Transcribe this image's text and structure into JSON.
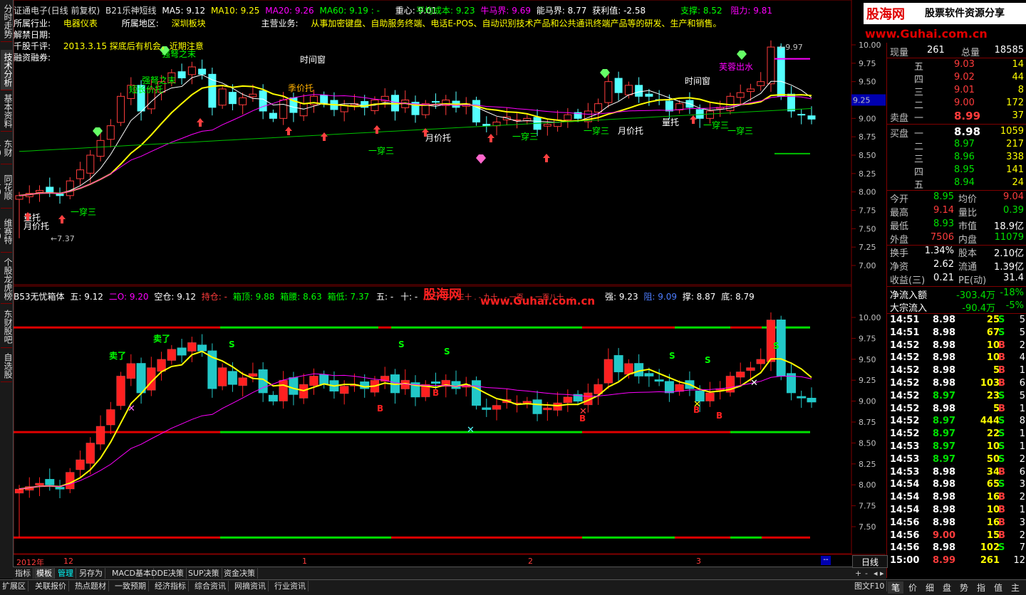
{
  "left_tabs": [
    {
      "label": "分时走势"
    },
    {
      "label": "技术分析"
    },
    {
      "label": "基本资料"
    },
    {
      "label": "东财10"
    },
    {
      "label": "同花顺10"
    },
    {
      "label": "维赛特10"
    },
    {
      "label": "个股龙虎榜"
    },
    {
      "label": "东财股吧"
    },
    {
      "label": "自选股"
    }
  ],
  "main_header": {
    "title": "证通电子(日线 前复权)",
    "indicator": "B21乐神短线",
    "ma5": "MA5: 9.12",
    "ma10": "MA10: 9.25",
    "ma20": "MA20: 9.26",
    "ma60": "MA60: 9.19",
    "ma60_tail": ": -",
    "zhongxin": "重心: 9.01",
    "pingjun": "平均成本: 9.23",
    "niuma": "牛马界: 9.69",
    "nengma": "能马界: 8.77",
    "huoli": "获利值: -2.58",
    "zhicheng": "支撑: 8.52",
    "zuli": "阻力: 9.81"
  },
  "info": {
    "industry_label": "所属行业:",
    "industry": "电器仪表",
    "region_label": "所属地区:",
    "region": "深圳板块",
    "business_label": "主营业务:",
    "business": "从事加密键盘、自助服务终端、电话E-POS、自动识别技术产品和公共通讯终端产品等的研发、生产和销售。",
    "unban_label": "解禁日期:",
    "review_label": "千股千评:",
    "review": "2013.3.15 探底后有机会，近期注意",
    "margin_label": "融资融券:"
  },
  "upper_labels": [
    "强弩之末",
    "强弩之末",
    "短长价托",
    "时间窗",
    "季价托",
    "月价托",
    "一穿三",
    "一穿三",
    "一穿三",
    "月价托",
    "量托",
    "时间窗",
    "芙蓉出水",
    "一穿三",
    "一穿三",
    "量托",
    "月价托",
    "一穿三"
  ],
  "upper_yaxis": [
    "10.00",
    "9.75",
    "9.50",
    "9.25",
    "9.00",
    "8.75",
    "8.50",
    "8.25",
    "8.00",
    "7.75",
    "7.50",
    "7.25",
    "7.00"
  ],
  "price_marks": {
    "high": "9.97",
    "low": "7.37",
    "current": "9.25"
  },
  "lower_header": {
    "name": "B53无忧箱体",
    "wu": "五: 9.12",
    "er": "二O: 9.20",
    "kongcang": "空仓: 9.12",
    "chicang": "持仓: -",
    "xiangding": "箱顶: 9.88",
    "xiangyao": "箱腰: 8.63",
    "xiangdi": "箱低: 7.37",
    "wu2": "五: -",
    "shi": "十: -",
    "ershi": "二十: -",
    "mid_partial": "三十  .  -  九十  .  -   一百  .  -    一百八十  .  -",
    "qiang": "强: 9.23",
    "zu": "阻: 9.09",
    "cheng": "撑: 8.87",
    "di": "底: 8.79"
  },
  "lower_labels": [
    "卖了",
    "卖了",
    "S",
    "S",
    "S",
    "S",
    "S",
    "S",
    "B",
    "B",
    "B",
    "B",
    "B"
  ],
  "lower_yaxis": [
    "10.00",
    "9.75",
    "9.50",
    "9.25",
    "9.00",
    "8.75",
    "8.50",
    "8.25",
    "8.00",
    "7.75",
    "7.50"
  ],
  "xaxis": {
    "year": "2012年",
    "m12": "12",
    "m1": "1",
    "m2": "2",
    "m3": "3"
  },
  "watermark": {
    "brand": "股海网",
    "sub": "股票软件资源分享",
    "url": "www.Guhai.com.cn"
  },
  "center_watermark": {
    "brand": "股海网",
    "url": "www.Guhai.com.cn"
  },
  "quote": {
    "xianliang_label": "现量",
    "xianliang": "261",
    "zongliang_label": "总量",
    "zongliang": "18585",
    "sell": [
      {
        "lv": "五",
        "price": "9.03",
        "vol": "14"
      },
      {
        "lv": "四",
        "price": "9.02",
        "vol": "44"
      },
      {
        "lv": "三",
        "price": "9.01",
        "vol": "8"
      },
      {
        "lv": "二",
        "price": "9.00",
        "vol": "172"
      },
      {
        "lv": "一",
        "price": "8.99",
        "vol": "37"
      }
    ],
    "sell_label": "卖盘",
    "buy_label": "买盘",
    "buy": [
      {
        "lv": "一",
        "price": "8.98",
        "vol": "1059"
      },
      {
        "lv": "二",
        "price": "8.97",
        "vol": "217"
      },
      {
        "lv": "三",
        "price": "8.96",
        "vol": "338"
      },
      {
        "lv": "四",
        "price": "8.95",
        "vol": "141"
      },
      {
        "lv": "五",
        "price": "8.94",
        "vol": "24"
      }
    ],
    "stats": [
      {
        "l1": "今开",
        "v1": "8.95",
        "l2": "均价",
        "v2": "9.04",
        "c1": "green",
        "c2": "red"
      },
      {
        "l1": "最高",
        "v1": "9.14",
        "l2": "量比",
        "v2": "0.39",
        "c1": "red",
        "c2": "green"
      },
      {
        "l1": "最低",
        "v1": "8.93",
        "l2": "市值",
        "v2": "18.9亿",
        "c1": "green",
        "c2": "white"
      },
      {
        "l1": "外盘",
        "v1": "7506",
        "l2": "内盘",
        "v2": "11079",
        "c1": "red",
        "c2": "green"
      },
      {
        "l1": "换手",
        "v1": "1.34%",
        "l2": "股本",
        "v2": "2.10亿",
        "c1": "white",
        "c2": "white"
      },
      {
        "l1": "净资",
        "v1": "2.62",
        "l2": "流通",
        "v2": "1.39亿",
        "c1": "white",
        "c2": "white"
      },
      {
        "l1": "收益(三)",
        "v1": "0.21",
        "l2": "PE(动)",
        "v2": "31.4",
        "c1": "white",
        "c2": "white"
      }
    ],
    "netflow_label": "净流入额",
    "netflow": "-303.4万",
    "netflow_pct": "-18%",
    "bigflow_label": "大宗流入",
    "bigflow": "-90.4万",
    "bigflow_pct": "-5%"
  },
  "ticks": [
    {
      "t": "14:51",
      "p": "8.98",
      "v": "25",
      "s": "S",
      "n": "5",
      "pc": "white"
    },
    {
      "t": "14:51",
      "p": "8.98",
      "v": "67",
      "s": "S",
      "n": "5",
      "pc": "white"
    },
    {
      "t": "14:52",
      "p": "8.98",
      "v": "10",
      "s": "B",
      "n": "2",
      "pc": "white"
    },
    {
      "t": "14:52",
      "p": "8.98",
      "v": "10",
      "s": "B",
      "n": "4",
      "pc": "white"
    },
    {
      "t": "14:52",
      "p": "8.98",
      "v": "5",
      "s": "B",
      "n": "1",
      "pc": "white"
    },
    {
      "t": "14:52",
      "p": "8.98",
      "v": "103",
      "s": "B",
      "n": "6",
      "pc": "white"
    },
    {
      "t": "14:52",
      "p": "8.97",
      "v": "23",
      "s": "S",
      "n": "5",
      "pc": "green"
    },
    {
      "t": "14:52",
      "p": "8.98",
      "v": "5",
      "s": "B",
      "n": "1",
      "pc": "white"
    },
    {
      "t": "14:52",
      "p": "8.97",
      "v": "444",
      "s": "S",
      "n": "8",
      "pc": "green"
    },
    {
      "t": "14:52",
      "p": "8.97",
      "v": "22",
      "s": "S",
      "n": "1",
      "pc": "green"
    },
    {
      "t": "14:53",
      "p": "8.97",
      "v": "10",
      "s": "S",
      "n": "1",
      "pc": "green"
    },
    {
      "t": "14:53",
      "p": "8.97",
      "v": "50",
      "s": "S",
      "n": "2",
      "pc": "green"
    },
    {
      "t": "14:53",
      "p": "8.98",
      "v": "34",
      "s": "B",
      "n": "6",
      "pc": "white"
    },
    {
      "t": "14:54",
      "p": "8.98",
      "v": "65",
      "s": "S",
      "n": "3",
      "pc": "white"
    },
    {
      "t": "14:54",
      "p": "8.98",
      "v": "16",
      "s": "B",
      "n": "2",
      "pc": "white"
    },
    {
      "t": "14:54",
      "p": "8.98",
      "v": "10",
      "s": "B",
      "n": "1",
      "pc": "white"
    },
    {
      "t": "14:56",
      "p": "8.98",
      "v": "16",
      "s": "B",
      "n": "3",
      "pc": "white"
    },
    {
      "t": "14:56",
      "p": "9.00",
      "v": "15",
      "s": "B",
      "n": "2",
      "pc": "red"
    },
    {
      "t": "14:56",
      "p": "8.98",
      "v": "102",
      "s": "S",
      "n": "7",
      "pc": "white"
    },
    {
      "t": "15:00",
      "p": "8.99",
      "v": "261",
      "s": "",
      "n": "12",
      "pc": "red"
    }
  ],
  "toolbar": {
    "zhibiao": "指标",
    "moban": "模板",
    "guanli": "管理",
    "lingcunwei": "另存为",
    "macd": "MACD基本",
    "dde": "DDE决策",
    "sup": "SUP决策",
    "zijin": "资金决策"
  },
  "bottom_tabs": [
    "扩展区",
    "关联报价",
    "热点题材",
    "一致预期",
    "经济指标",
    "综合资讯",
    "网摘资讯",
    "行业资讯"
  ],
  "right_bottom": {
    "rixian": "日线",
    "tuwen": "图文F10"
  },
  "right_icons": [
    "笔",
    "价",
    "细",
    "盘",
    "势",
    "指",
    "值",
    "主"
  ]
}
